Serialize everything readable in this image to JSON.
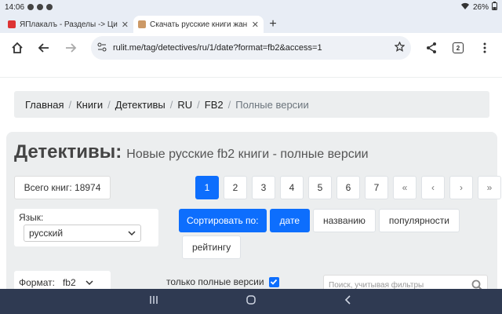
{
  "status": {
    "time": "14:06",
    "battery": "26%"
  },
  "tabs": [
    {
      "title": "ЯПлакалъ - Разделы -> Цит",
      "favicon_color": "#d33"
    },
    {
      "title": "Скачать русские книги жан",
      "favicon_color": "#c96"
    }
  ],
  "address": {
    "url": "rulit.me/tag/detectives/ru/1/date?format=fb2&access=1",
    "tab_count": "2"
  },
  "breadcrumb": [
    "Главная",
    "Книги",
    "Детективы",
    "RU",
    "FB2",
    "Полные версии"
  ],
  "heading": {
    "main": "Детективы:",
    "sub": "Новые русские fb2 книги - полные версии"
  },
  "total": "Всего книг: 18974",
  "pagination": [
    "1",
    "2",
    "3",
    "4",
    "5",
    "6",
    "7",
    "«",
    "‹",
    "›",
    "»"
  ],
  "language": {
    "label": "Язык:",
    "value": "русский"
  },
  "sort": {
    "label": "Сортировать по:",
    "options": [
      "дате",
      "названию",
      "популярности",
      "рейтингу"
    ]
  },
  "format": {
    "label": "Формат:",
    "value": "fb2"
  },
  "full_only": "только полные версии",
  "search": {
    "placeholder": "Поиск, учитывая фильтры"
  },
  "colors": {
    "primary": "#0d6efd",
    "panel": "#eceeef",
    "navbar": "#2f3a52"
  }
}
